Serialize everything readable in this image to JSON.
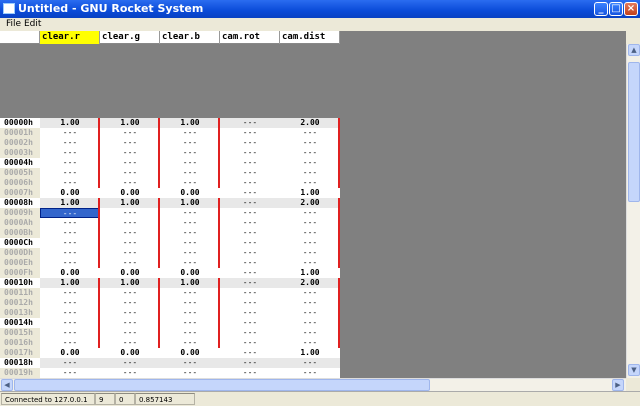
{
  "window": {
    "title": "Untitled - GNU Rocket System"
  },
  "menu": [
    {
      "label": "File"
    },
    {
      "label": "Edit"
    }
  ],
  "tracks": [
    "clear.r",
    "clear.g",
    "clear.b",
    "cam.rot",
    "cam.dist"
  ],
  "active_track_index": 0,
  "rows": [
    {
      "label": "00000h",
      "major": true,
      "values": [
        "1.00",
        "1.00",
        "1.00",
        "---",
        "2.00"
      ]
    },
    {
      "label": "00001h",
      "major": false,
      "values": [
        "---",
        "---",
        "---",
        "---",
        "---"
      ]
    },
    {
      "label": "00002h",
      "major": false,
      "values": [
        "---",
        "---",
        "---",
        "---",
        "---"
      ]
    },
    {
      "label": "00003h",
      "major": false,
      "values": [
        "---",
        "---",
        "---",
        "---",
        "---"
      ]
    },
    {
      "label": "00004h",
      "major": true,
      "values": [
        "---",
        "---",
        "---",
        "---",
        "---"
      ]
    },
    {
      "label": "00005h",
      "major": false,
      "values": [
        "---",
        "---",
        "---",
        "---",
        "---"
      ]
    },
    {
      "label": "00006h",
      "major": false,
      "values": [
        "---",
        "---",
        "---",
        "---",
        "---"
      ]
    },
    {
      "label": "00007h",
      "major": false,
      "values": [
        "0.00",
        "0.00",
        "0.00",
        "---",
        "1.00"
      ]
    },
    {
      "label": "00008h",
      "major": true,
      "values": [
        "1.00",
        "1.00",
        "1.00",
        "---",
        "2.00"
      ]
    },
    {
      "label": "00009h",
      "major": false,
      "values": [
        "---",
        "---",
        "---",
        "---",
        "---"
      ]
    },
    {
      "label": "0000Ah",
      "major": false,
      "values": [
        "---",
        "---",
        "---",
        "---",
        "---"
      ]
    },
    {
      "label": "0000Bh",
      "major": false,
      "values": [
        "---",
        "---",
        "---",
        "---",
        "---"
      ]
    },
    {
      "label": "0000Ch",
      "major": true,
      "values": [
        "---",
        "---",
        "---",
        "---",
        "---"
      ]
    },
    {
      "label": "0000Dh",
      "major": false,
      "values": [
        "---",
        "---",
        "---",
        "---",
        "---"
      ]
    },
    {
      "label": "0000Eh",
      "major": false,
      "values": [
        "---",
        "---",
        "---",
        "---",
        "---"
      ]
    },
    {
      "label": "0000Fh",
      "major": false,
      "values": [
        "0.00",
        "0.00",
        "0.00",
        "---",
        "1.00"
      ]
    },
    {
      "label": "00010h",
      "major": true,
      "values": [
        "1.00",
        "1.00",
        "1.00",
        "---",
        "2.00"
      ]
    },
    {
      "label": "00011h",
      "major": false,
      "values": [
        "---",
        "---",
        "---",
        "---",
        "---"
      ]
    },
    {
      "label": "00012h",
      "major": false,
      "values": [
        "---",
        "---",
        "---",
        "---",
        "---"
      ]
    },
    {
      "label": "00013h",
      "major": false,
      "values": [
        "---",
        "---",
        "---",
        "---",
        "---"
      ]
    },
    {
      "label": "00014h",
      "major": true,
      "values": [
        "---",
        "---",
        "---",
        "---",
        "---"
      ]
    },
    {
      "label": "00015h",
      "major": false,
      "values": [
        "---",
        "---",
        "---",
        "---",
        "---"
      ]
    },
    {
      "label": "00016h",
      "major": false,
      "values": [
        "---",
        "---",
        "---",
        "---",
        "---"
      ]
    },
    {
      "label": "00017h",
      "major": false,
      "values": [
        "0.00",
        "0.00",
        "0.00",
        "---",
        "1.00"
      ]
    },
    {
      "label": "00018h",
      "major": true,
      "values": [
        "---",
        "---",
        "---",
        "---",
        "---"
      ]
    },
    {
      "label": "00019h",
      "major": false,
      "values": [
        "---",
        "---",
        "---",
        "---",
        "---"
      ]
    }
  ],
  "selected": {
    "row": 9,
    "col": 0
  },
  "status": {
    "connection": "Connected to 127.0.0.1",
    "row": "9",
    "track": "0",
    "time": "0.857143"
  },
  "colors": {
    "interp_line": "#e02020",
    "active_track": "#ffff00",
    "selection": "#3366cc"
  }
}
